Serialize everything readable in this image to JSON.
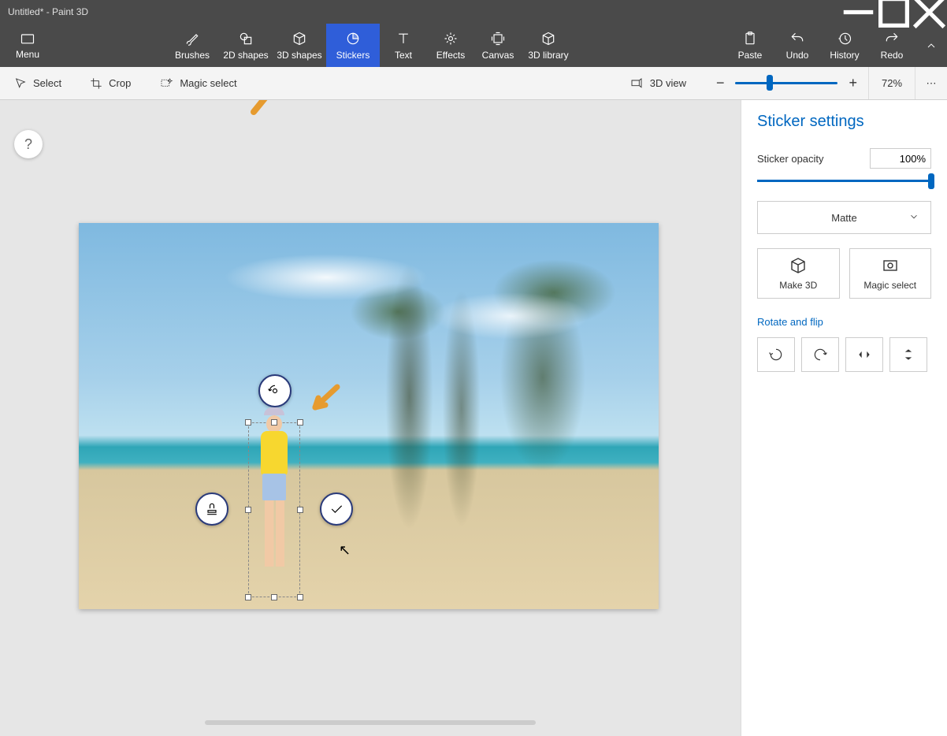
{
  "window": {
    "title": "Untitled* - Paint 3D"
  },
  "ribbon": {
    "menu": "Menu",
    "tools": {
      "brushes": "Brushes",
      "shapes2d": "2D shapes",
      "shapes3d": "3D shapes",
      "stickers": "Stickers",
      "text": "Text",
      "effects": "Effects",
      "canvas": "Canvas",
      "library3d": "3D library",
      "paste": "Paste",
      "undo": "Undo",
      "history": "History",
      "redo": "Redo"
    }
  },
  "toolbar2": {
    "select": "Select",
    "crop": "Crop",
    "magic_select": "Magic select",
    "view3d": "3D view",
    "zoom_pct": "72%"
  },
  "sidepanel": {
    "title": "Sticker settings",
    "opacity_label": "Sticker opacity",
    "opacity_value": "100%",
    "material": "Matte",
    "make3d": "Make 3D",
    "magic_select": "Magic select",
    "rotate_flip": "Rotate and flip"
  },
  "help": "?"
}
